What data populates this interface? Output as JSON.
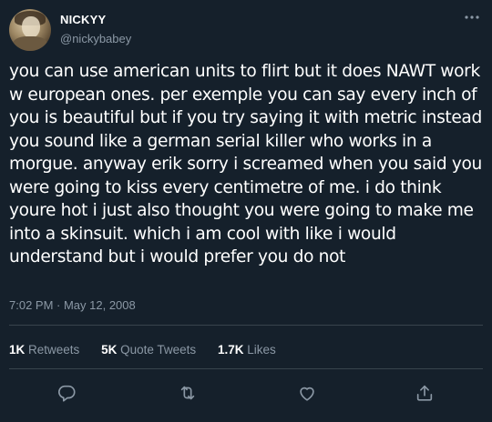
{
  "tweet": {
    "author_name": "NICKYY",
    "handle": "@nickybabey",
    "text": "you can use american units to flirt but it does NAWT work w european ones. per exemple you can say every inch of you is beautiful but if you try saying it with metric instead you sound like a german serial killer who works in a morgue. anyway erik sorry i screamed when you said you were going to kiss every centimetre of me. i do think youre hot i just also thought you were going to make me into a skinsuit. which i am cool with like i would understand but i would prefer you do not",
    "timestamp": "7:02 PM · May 12, 2008",
    "retweets_count": "1K",
    "retweets_label": "Retweets",
    "quote_tweets_count": "5K",
    "quote_tweets_label": "Quote Tweets",
    "likes_count": "1.7K",
    "likes_label": "Likes"
  },
  "icons": {
    "more": "more-horizontal-icon",
    "reply": "reply-icon",
    "retweet": "retweet-icon",
    "like": "heart-icon",
    "share": "share-icon"
  },
  "colors": {
    "background": "#15202b",
    "text": "#ffffff",
    "secondary_text": "#8b98a5",
    "divider": "#38444d"
  }
}
